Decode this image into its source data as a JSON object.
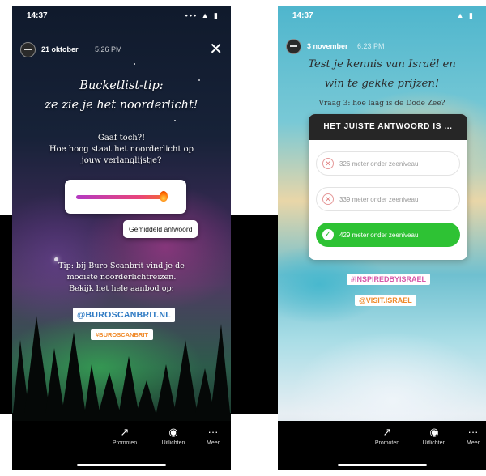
{
  "left_story": {
    "status": {
      "time": "14:37",
      "signal": "••• ▲ ▮"
    },
    "header": {
      "date": "21 oktober",
      "time": "5:26 PM",
      "close_icon": "close-icon"
    },
    "title_lines": [
      "Bucketlist-tip:",
      "ze zie je het noorderlicht!"
    ],
    "subtitle_lines": [
      "Gaaf toch?!",
      "Hoe hoog staat het noorderlicht op",
      "jouw verlanglijstje?"
    ],
    "slider": {
      "emoji": "fire-icon",
      "level": 0.95
    },
    "average_button": "Gemiddeld antwoord",
    "tip_lines": [
      "Tip: bij Buro Scanbrit vind je de",
      "mooiste noorderlichtreizen.",
      "Bekijk het hele aanbod op:"
    ],
    "mention": "@BUROSCANBRIT.NL",
    "hashtag": "#BUROSCANBRIT",
    "actions": [
      "Promoten",
      "Uitlichten",
      "Meer"
    ]
  },
  "right_story": {
    "status": {
      "time": "14:37",
      "signal": "▲ ▮"
    },
    "header": {
      "username": "3 november",
      "time": "6:23 PM"
    },
    "title_lines": [
      "Test je kennis van Israël en",
      "win te gekke prijzen!"
    ],
    "question": "Vraag 3: hoe laag is de Dode Zee?",
    "quiz": {
      "heading": "HET JUISTE ANTWOORD IS ...",
      "options": [
        {
          "text": "326 meter onder zeeniveau",
          "state": "wrong"
        },
        {
          "text": "339 meter onder zeeniveau",
          "state": "wrong"
        },
        {
          "text": "429 meter onder zeeniveau",
          "state": "correct"
        }
      ]
    },
    "tags": [
      "#INSPIREDBYISRAEL",
      "@VISIT.ISRAEL"
    ],
    "actions": [
      "Promoten",
      "Uitlichten",
      "Meer"
    ]
  },
  "colors": {
    "correct": "#2ec234",
    "mention": "#2e7ac3",
    "hashtag": "#f08a2a",
    "tag": "#d857a9"
  }
}
